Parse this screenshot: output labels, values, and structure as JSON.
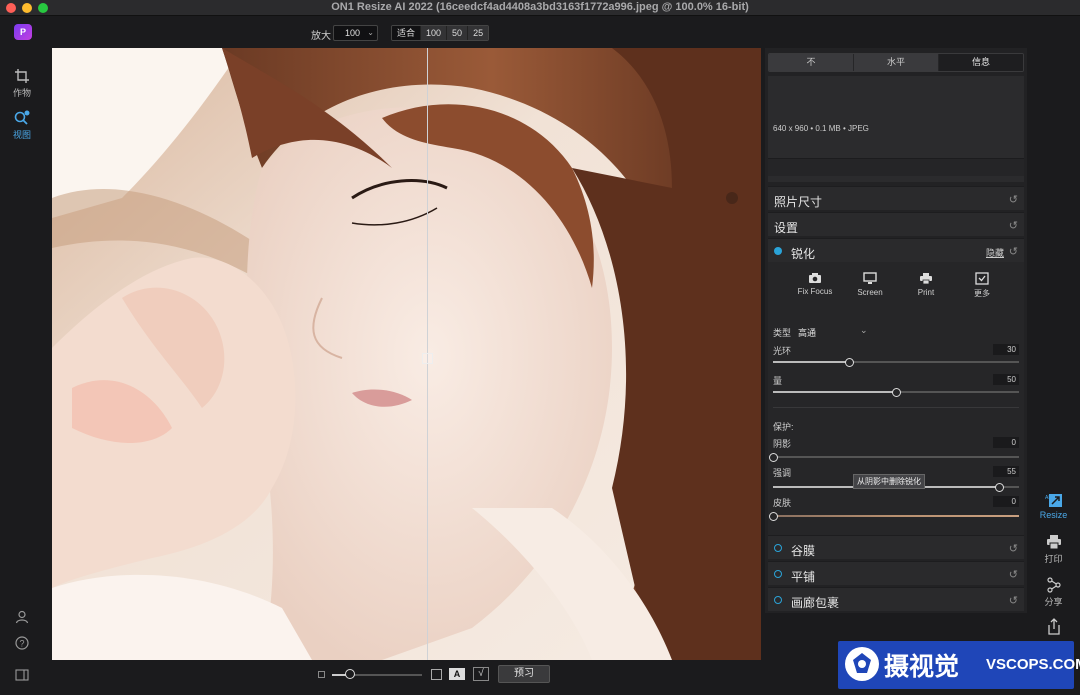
{
  "window": {
    "title": "ON1 Resize AI 2022 (16ceedcf4ad4408a3bd3163f1772a996.jpeg @ 100.0% 16-bit)"
  },
  "toolbar": {
    "logo_text": "P",
    "zoom_label": "放大",
    "zoom_value": "100",
    "fit_buttons": [
      "适合",
      "100",
      "50",
      "25"
    ]
  },
  "left_tools": [
    {
      "label": "作物",
      "icon": "crop-icon"
    },
    {
      "label": "视图",
      "icon": "zoom-view-icon",
      "active": true
    }
  ],
  "panel": {
    "tabs": [
      "不",
      "水平",
      "信息"
    ],
    "info_text": "640 x 960 • 0.1 MB • JPEG",
    "sections": {
      "photo_size": "照片尺寸",
      "settings": "设置",
      "sharpen": "锐化",
      "hide": "隐藏",
      "grain": "谷膜",
      "tiling": "平铺",
      "gallery_wrap": "画廊包裹"
    },
    "sharpen_modes": [
      "Fix Focus",
      "Screen",
      "Print",
      "更多"
    ],
    "type_label": "类型",
    "type_value": "高通",
    "halo": {
      "label": "光环",
      "value": "30",
      "level": 0.31
    },
    "amount": {
      "label": "量",
      "value": "50",
      "level": 0.5
    },
    "protect_label": "保护:",
    "shadows": {
      "label": "阴影",
      "value": "0",
      "level": 0.0
    },
    "highlights": {
      "label": "强调",
      "value": "55",
      "level": 0.92
    },
    "skin": {
      "label": "皮肤",
      "value": "0",
      "level": 0.0
    },
    "tooltip": "从阴影中删除锐化"
  },
  "bottombar": {
    "preview": "预习",
    "a_label": "A",
    "check": "√"
  },
  "right_tools": [
    {
      "label": "Resize",
      "icon": "resize-icon",
      "active": true
    },
    {
      "label": "打印",
      "icon": "print-icon"
    },
    {
      "label": "分享",
      "icon": "share-icon"
    },
    {
      "label": "",
      "icon": "export-icon"
    }
  ],
  "watermark": {
    "cn": "摄视觉",
    "en": "VSCOPS.COM"
  },
  "colors": {
    "accent": "#4aa8e8",
    "dot": "#2aa3d8",
    "watermark": "#1f46b8"
  }
}
